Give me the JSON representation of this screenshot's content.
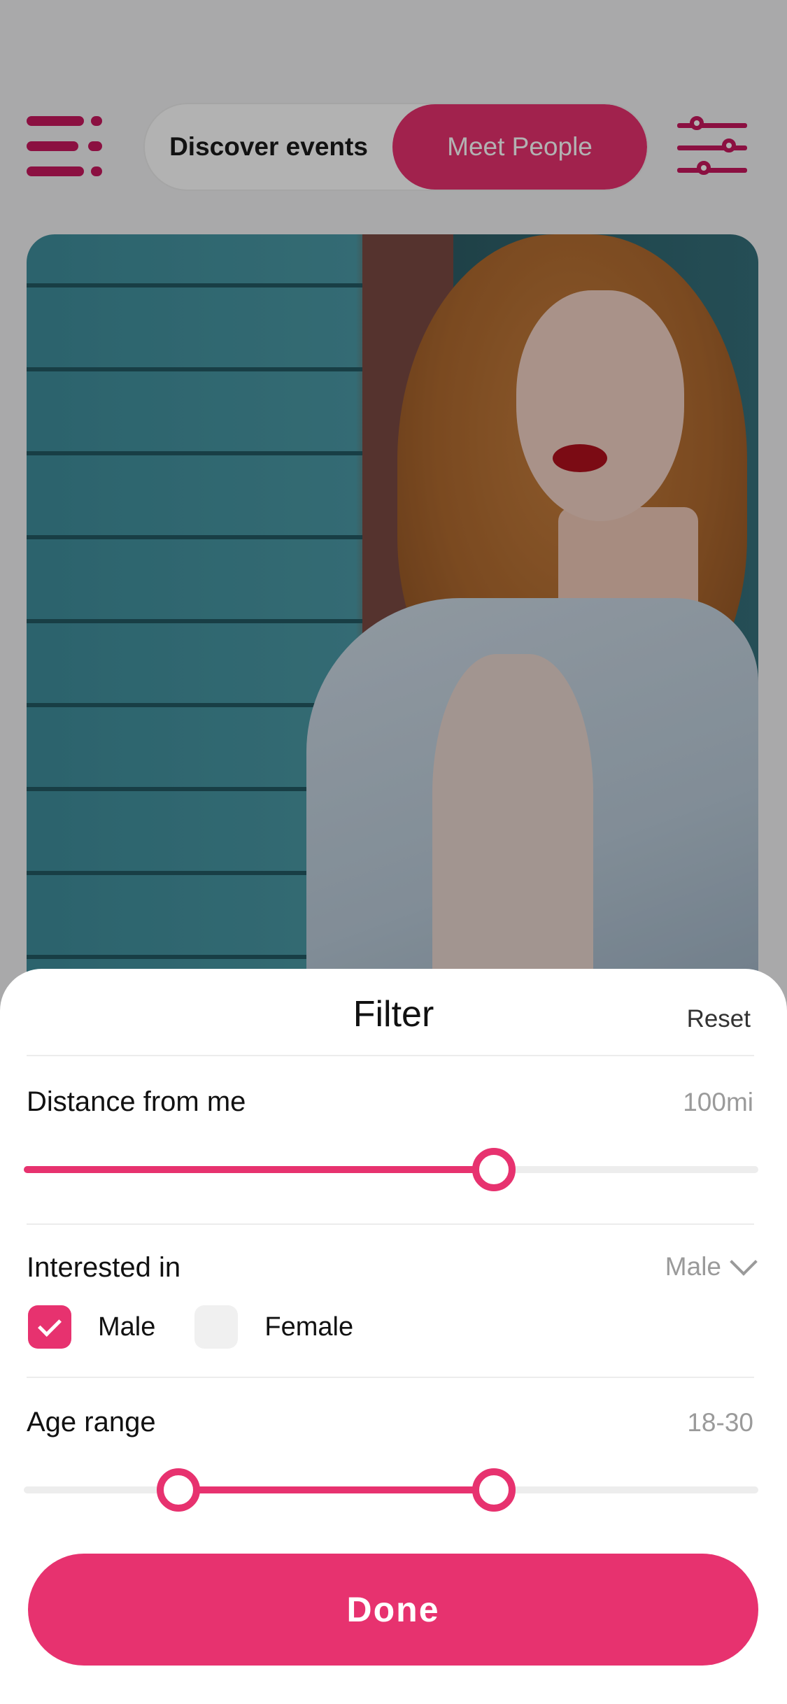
{
  "header": {
    "tabs": [
      {
        "label": "Discover events",
        "active": false
      },
      {
        "label": "Meet People",
        "active": true
      }
    ]
  },
  "filter": {
    "title": "Filter",
    "reset_label": "Reset",
    "distance": {
      "label": "Distance from me",
      "value_text": "100mi",
      "level_fraction": 0.64
    },
    "interested": {
      "label": "Interested in",
      "selected_value": "Male",
      "options": [
        {
          "label": "Male",
          "checked": true
        },
        {
          "label": "Female",
          "checked": false
        }
      ]
    },
    "age": {
      "label": "Age range",
      "value_text": "18-30",
      "low_fraction": 0.21,
      "high_fraction": 0.64
    },
    "done_label": "Done"
  },
  "colors": {
    "accent": "#e7326f",
    "accent_dark": "#c8175d"
  },
  "icons": {
    "menu": "menu-icon",
    "filter": "sliders-icon",
    "dropdown": "chevron-down-icon",
    "check": "check-icon"
  }
}
